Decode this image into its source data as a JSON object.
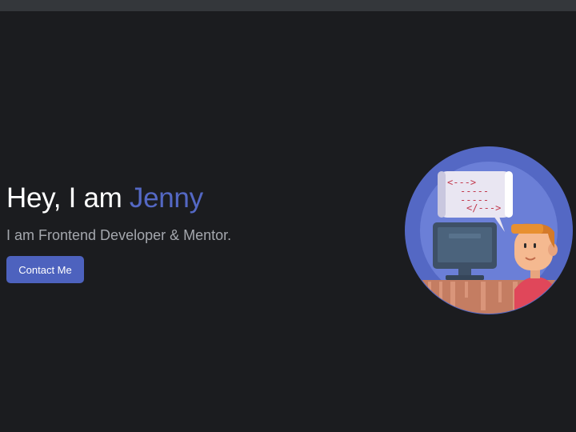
{
  "hero": {
    "greeting": "Hey, I am ",
    "name": "Jenny",
    "subtitle": "I am Frontend Developer & Mentor.",
    "contact_button": "Contact Me"
  },
  "illustration": {
    "code_line_1": "<--->",
    "code_line_2": "-----",
    "code_line_3": "-----",
    "code_line_4": "</--->"
  },
  "colors": {
    "background": "#1b1c1f",
    "accent": "#5468c4",
    "button": "#4d62be",
    "subtitle": "#a4a7ad"
  }
}
